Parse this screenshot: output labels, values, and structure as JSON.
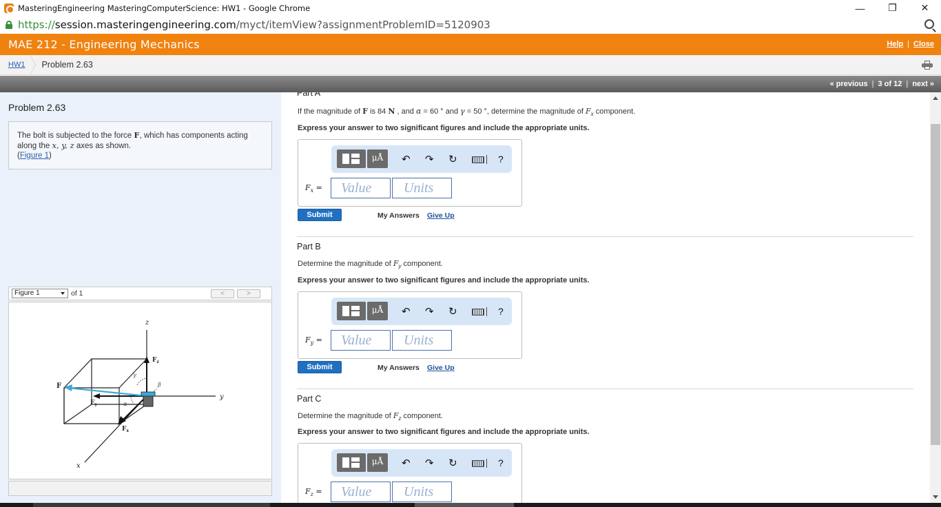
{
  "window": {
    "title": "MasteringEngineering MasteringComputerScience: HW1 - Google Chrome",
    "minimize": "—",
    "restore": "❐",
    "close": "✕"
  },
  "address": {
    "scheme": "https://",
    "host": "session.masteringengineering.com",
    "path": "/myct/itemView?assignmentProblemID=5120903"
  },
  "course": {
    "title": "MAE 212 - Engineering Mechanics",
    "help_label": "Help",
    "close_label": "Close",
    "separator": "|",
    "accent": "#f0820f"
  },
  "breadcrumb": {
    "assignment": "HW1",
    "current": "Problem 2.63"
  },
  "nav": {
    "previous": "« previous",
    "position": "3 of 12",
    "next": "next »",
    "separator": "|"
  },
  "problem": {
    "title": "Problem 2.63",
    "description": {
      "prefix": "The bolt is subjected to the force ",
      "force": "F",
      "middle": ", which has components acting along the ",
      "axes": "x, y, z",
      "suffix": " axes as shown.",
      "figure_link": "Figure 1",
      "open_paren": "(",
      "close_paren": ")"
    }
  },
  "figure": {
    "selected": "Figure 1",
    "of_label": "of 1",
    "prev": "<",
    "next": ">",
    "labels": {
      "z": "z",
      "y": "y",
      "x": "x",
      "F": "F",
      "Fz": "F",
      "Fz_sub": "z",
      "Fy": "F",
      "Fy_sub": "y",
      "Fx": "F",
      "Fx_sub": "x",
      "alpha": "α",
      "beta": "β",
      "gamma": "γ"
    },
    "force_color": "#3aa9d8"
  },
  "parts": [
    {
      "title": "Part A",
      "question": {
        "t1": "If the magnitude of ",
        "F": "F",
        "t2": " is 84 ",
        "unit": "N",
        "t3": " , and ",
        "alpha": "α",
        "t4": " = 60 ° and ",
        "gamma": "γ",
        "t5": " = 50 °, determine the magnitude of ",
        "comp": "F",
        "comp_sub": "x",
        "t6": " component."
      },
      "express": "Express your answer to two significant figures and include the appropriate units.",
      "field_label": "F",
      "field_sub": "x",
      "field_eq": " =",
      "value_placeholder": "Value",
      "units_placeholder": "Units",
      "submit": "Submit",
      "my_answers": "My Answers",
      "give_up": "Give Up"
    },
    {
      "title": "Part B",
      "question": {
        "t1": "Determine the magnitude of ",
        "comp": "F",
        "comp_sub": "y",
        "t2": " component."
      },
      "express": "Express your answer to two significant figures and include the appropriate units.",
      "field_label": "F",
      "field_sub": "y",
      "field_eq": " =",
      "value_placeholder": "Value",
      "units_placeholder": "Units",
      "submit": "Submit",
      "my_answers": "My Answers",
      "give_up": "Give Up"
    },
    {
      "title": "Part C",
      "question": {
        "t1": "Determine the magnitude of ",
        "comp": "F",
        "comp_sub": "z",
        "t2": " component."
      },
      "express": "Express your answer to two significant figures and include the appropriate units.",
      "field_label": "F",
      "field_sub": "z",
      "field_eq": " =",
      "value_placeholder": "Value",
      "units_placeholder": "Units"
    }
  ],
  "toolbar": {
    "units_label": "μÅ",
    "undo": "↶",
    "redo": "↷",
    "reset": "↻",
    "kb_sep": "|",
    "help": "?"
  }
}
